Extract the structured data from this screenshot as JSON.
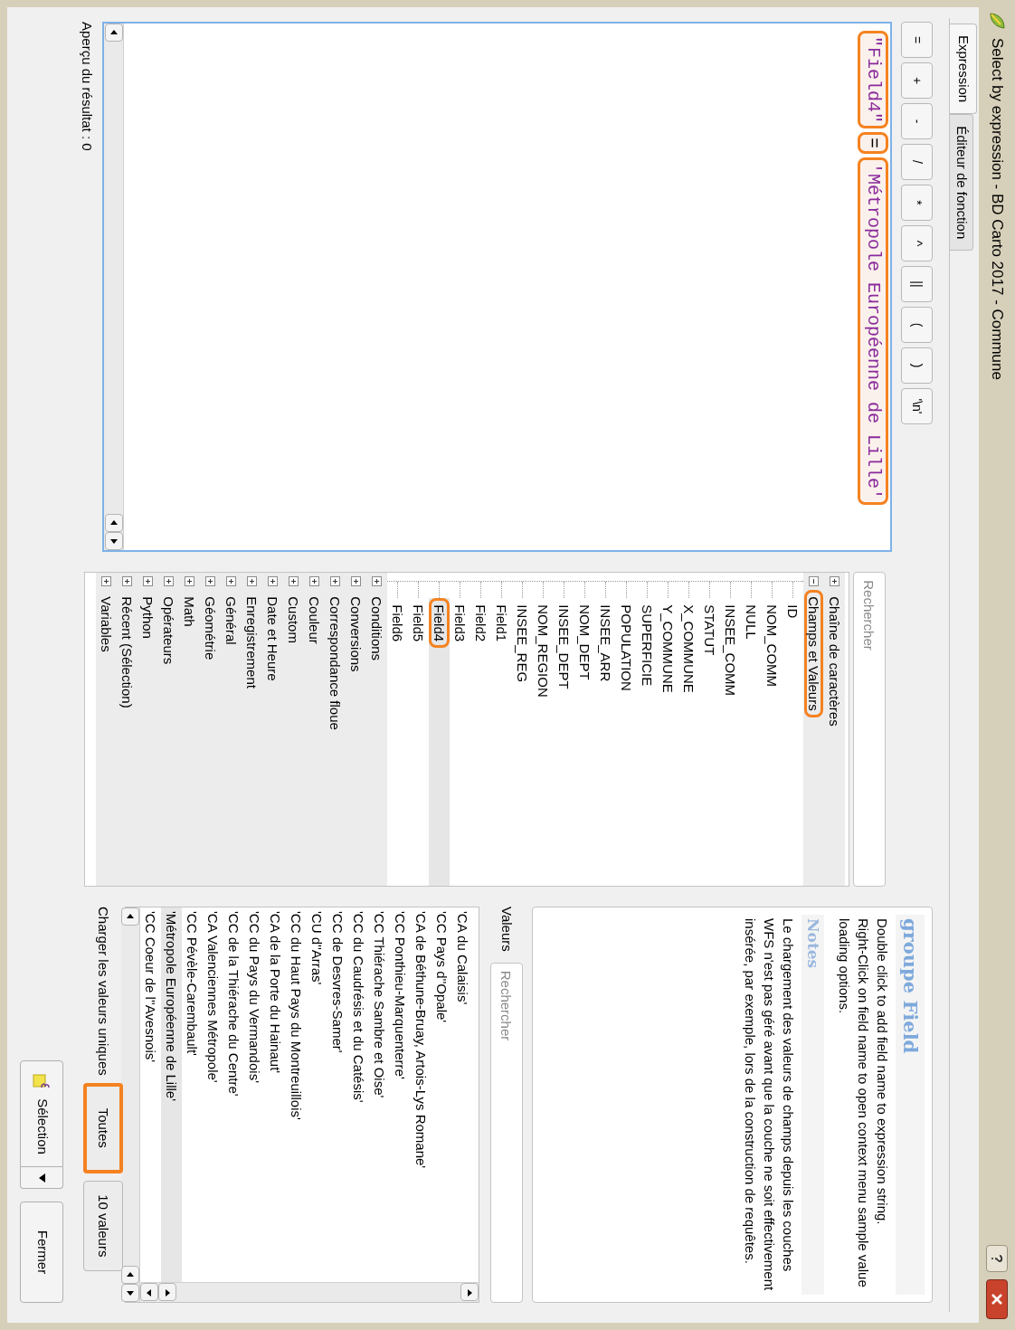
{
  "window": {
    "title": "Select by expression - BD Carto 2017 - Commune"
  },
  "tabs": [
    {
      "label": "Expression",
      "selected": true
    },
    {
      "label": "Éditeur de fonction",
      "selected": false
    }
  ],
  "operators": [
    "=",
    "+",
    "-",
    "/",
    "*",
    "^",
    "||",
    "(",
    ")",
    "'\\n'"
  ],
  "expression": {
    "tokens": [
      {
        "text": "\"Field4\"",
        "kind": "field",
        "highlighted": true
      },
      {
        "text": "=",
        "kind": "operator",
        "highlighted": true
      },
      {
        "text": "'Métropole Européenne de Lille'",
        "kind": "string",
        "highlighted": true
      }
    ]
  },
  "preview": "Aperçu du résultat : 0",
  "function_search": {
    "placeholder": "Rechercher"
  },
  "tree": [
    {
      "label": "Chaîne de caractères",
      "expanded": false,
      "selected": false,
      "highlighted": false
    },
    {
      "label": "Champs et Valeurs",
      "expanded": true,
      "selected": false,
      "highlighted": true,
      "children": [
        {
          "label": "ID",
          "selected": false,
          "highlighted": false
        },
        {
          "label": "NOM_COMM",
          "selected": false,
          "highlighted": false
        },
        {
          "label": "NULL",
          "selected": false,
          "highlighted": false
        },
        {
          "label": "INSEE_COMM",
          "selected": false,
          "highlighted": false
        },
        {
          "label": "STATUT",
          "selected": false,
          "highlighted": false
        },
        {
          "label": "X_COMMUNE",
          "selected": false,
          "highlighted": false
        },
        {
          "label": "Y_COMMUNE",
          "selected": false,
          "highlighted": false
        },
        {
          "label": "SUPERFICIE",
          "selected": false,
          "highlighted": false
        },
        {
          "label": "POPULATION",
          "selected": false,
          "highlighted": false
        },
        {
          "label": "INSEE_ARR",
          "selected": false,
          "highlighted": false
        },
        {
          "label": "NOM_DEPT",
          "selected": false,
          "highlighted": false
        },
        {
          "label": "INSEE_DEPT",
          "selected": false,
          "highlighted": false
        },
        {
          "label": "NOM_REGION",
          "selected": false,
          "highlighted": false
        },
        {
          "label": "INSEE_REG",
          "selected": false,
          "highlighted": false
        },
        {
          "label": "Field1",
          "selected": false,
          "highlighted": false
        },
        {
          "label": "Field2",
          "selected": false,
          "highlighted": false
        },
        {
          "label": "Field3",
          "selected": false,
          "highlighted": false
        },
        {
          "label": "Field4",
          "selected": true,
          "highlighted": true
        },
        {
          "label": "Field5",
          "selected": false,
          "highlighted": false
        },
        {
          "label": "Field6",
          "selected": false,
          "highlighted": false
        }
      ]
    },
    {
      "label": "Conditions",
      "expanded": false,
      "selected": false,
      "highlighted": false
    },
    {
      "label": "Conversions",
      "expanded": false,
      "selected": false,
      "highlighted": false
    },
    {
      "label": "Correspondance floue",
      "expanded": false,
      "selected": false,
      "highlighted": false
    },
    {
      "label": "Couleur",
      "expanded": false,
      "selected": false,
      "highlighted": false
    },
    {
      "label": "Custom",
      "expanded": false,
      "selected": false,
      "highlighted": false
    },
    {
      "label": "Date et Heure",
      "expanded": false,
      "selected": false,
      "highlighted": false
    },
    {
      "label": "Enregistrement",
      "expanded": false,
      "selected": false,
      "highlighted": false
    },
    {
      "label": "Général",
      "expanded": false,
      "selected": false,
      "highlighted": false
    },
    {
      "label": "Géométrie",
      "expanded": false,
      "selected": false,
      "highlighted": false
    },
    {
      "label": "Math",
      "expanded": false,
      "selected": false,
      "highlighted": false
    },
    {
      "label": "Opérateurs",
      "expanded": false,
      "selected": false,
      "highlighted": false
    },
    {
      "label": "Python",
      "expanded": false,
      "selected": false,
      "highlighted": false
    },
    {
      "label": "Récent (Sélection)",
      "expanded": false,
      "selected": false,
      "highlighted": false
    },
    {
      "label": "Variables",
      "expanded": false,
      "selected": false,
      "highlighted": false
    }
  ],
  "help": {
    "title": "groupe Field",
    "lines": [
      "Double click to add field name to expression string.",
      "Right-Click on field name to open context menu sample value loading options."
    ],
    "notes_title": "Notes",
    "notes": "Le chargement des valeurs de champs depuis les couches WFS n'est pas géré avant que la couche ne soit effectivement insérée, par exemple, lors de la construction de requêtes."
  },
  "values": {
    "label": "Valeurs",
    "search_placeholder": "Rechercher",
    "items": [
      {
        "text": "'CA du Calaisis'",
        "selected": false
      },
      {
        "text": "'CC Pays d''Opale'",
        "selected": false
      },
      {
        "text": "'CA de Béthune-Bruay, Artois-Lys Romane'",
        "selected": false
      },
      {
        "text": "'CC Ponthieu-Marquenterre'",
        "selected": false
      },
      {
        "text": "'CC Thiérache Sambre et Oise'",
        "selected": false
      },
      {
        "text": "'CC du Caudrésis et du Catésis'",
        "selected": false
      },
      {
        "text": "'CC de Desvres-Samer'",
        "selected": false
      },
      {
        "text": "'CU d''Arras'",
        "selected": false
      },
      {
        "text": "'CC du Haut Pays du Montreuillois'",
        "selected": false
      },
      {
        "text": "'CA de la Porte du Hainaut'",
        "selected": false
      },
      {
        "text": "'CC du Pays du Vermandois'",
        "selected": false
      },
      {
        "text": "'CC de la Thiérache du Centre'",
        "selected": false
      },
      {
        "text": "'CA Valenciennes Métropole'",
        "selected": false
      },
      {
        "text": "'CC Pévèle-Carembault'",
        "selected": false
      },
      {
        "text": "'Métropole Européenne de Lille'",
        "selected": true
      },
      {
        "text": "'CC Coeur de l''Avesnois'",
        "selected": false
      }
    ]
  },
  "load_unique": {
    "label": "Charger les valeurs uniques",
    "buttons": [
      {
        "label": "Toutes",
        "highlighted": true
      },
      {
        "label": "10 valeurs",
        "highlighted": false
      }
    ]
  },
  "buttons": [
    {
      "label": "Sélection",
      "kind": "split"
    },
    {
      "label": "Fermer",
      "kind": "plain"
    }
  ]
}
